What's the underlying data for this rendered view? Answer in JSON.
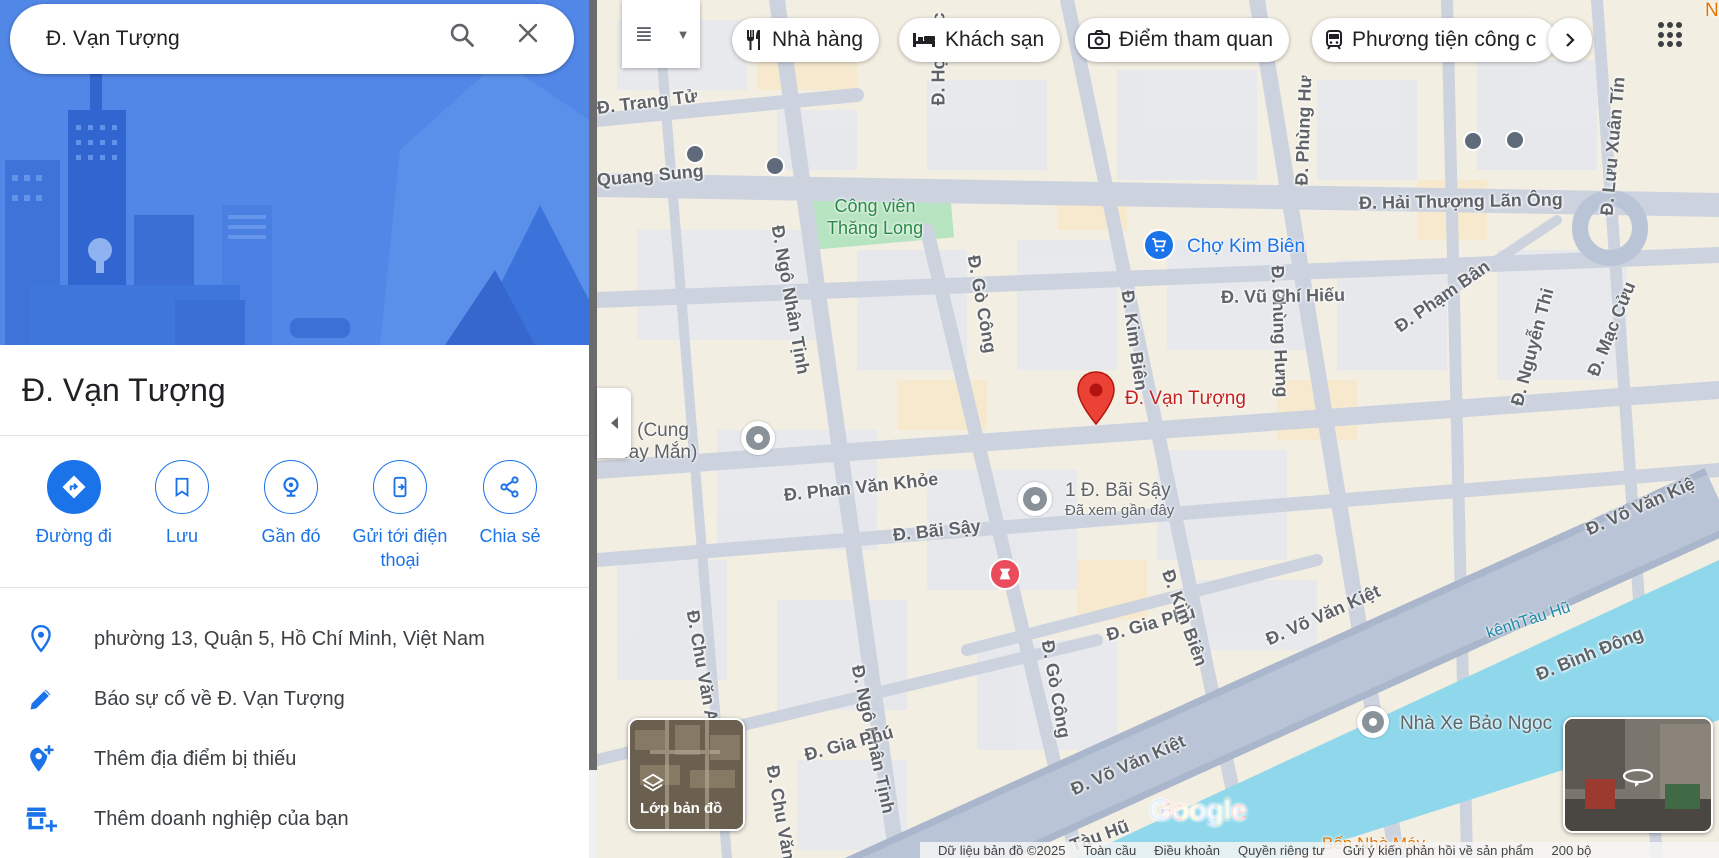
{
  "search": {
    "value": "Đ. Vạn Tượng"
  },
  "place": {
    "title": "Đ. Vạn Tượng"
  },
  "actions": [
    {
      "label": "Đường đi"
    },
    {
      "label": "Lưu"
    },
    {
      "label": "Gần đó"
    },
    {
      "label": "Gửi tới điện",
      "label2": "thoại"
    },
    {
      "label": "Chia sẻ"
    }
  ],
  "info": [
    {
      "text": "phường 13, Quận 5, Hồ Chí Minh, Việt Nam",
      "icon": "location-pin-icon"
    },
    {
      "text": "Báo sự cố về Đ. Vạn Tượng",
      "icon": "pencil-icon"
    },
    {
      "text": "Thêm địa điểm bị thiếu",
      "icon": "add-location-icon"
    },
    {
      "text": "Thêm doanh nghiệp của bạn",
      "icon": "add-business-icon"
    }
  ],
  "map": {
    "chips": [
      "Nhà hàng",
      "Khách sạn",
      "Điểm tham quan",
      "Phương tiện công c"
    ],
    "streets": [
      "Đ. Trang Tử",
      "Quang Sung",
      "Đ. Học Lạc",
      "Đ. Ngô Nhân Tịnh",
      "Đ. Gò Công",
      "Đ. Kim Biên",
      "Đ. Phùng Hưng",
      "Đ. Phùng Hư",
      "Đ. Hải Thượng Lãn Ông",
      "Đ. Vũ Chí Hiếu",
      "Đ. Phạm Bân",
      "Đ. Nguyễn Thi",
      "Đ. Mạc Cửu",
      "Đ. Lưu Xuân Tín",
      "Đ. Phan Văn Khỏe",
      "Đ. Bãi Sậy",
      "Đ. Gia Phú",
      "Đ. Chu Văn An",
      "Đ. Ngô Nhân Tịnh",
      "Đ. Gò Công",
      "Đ. Kim Biên",
      "Đ. Võ Văn Kiệt",
      "Đ. Võ Văn Kiệt",
      "Đ. Bình Đông",
      "Đ. Gia Phú",
      "Đ. Chu Văn",
      "Đ. Võ Văn Kiệ",
      "Tàu Hũ"
    ],
    "river_label": "kênhTàu Hũ",
    "park_label_1": "Công viên",
    "park_label_2": "Thăng Long",
    "market": "Chợ Kim Biên",
    "pin_label": "Đ. Vạn Tượng",
    "palace_1": "lace (Cung",
    "palace_2": "n May Mắn)",
    "recent_name": "1 Đ. Bãi Sậy",
    "recent_sub": "Đã xem gần đây",
    "bus_station": "Nhà Xe Bảo Ngọc",
    "bottom_poi": "Bến Nhà Máy...",
    "corner_letter": "N",
    "layers_label": "Lớp bản đồ",
    "google": "Google",
    "footer": [
      "Dữ liệu bản đồ ©2025",
      "Toàn cầu",
      "Điều khoản",
      "Quyền riêng tư",
      "Gửi ý kiến phản hồi về sản phẩm",
      "200 bộ"
    ]
  },
  "colors": {
    "accent": "#1a73e8",
    "pin": "#ea4335",
    "river": "#8fd8ec",
    "road": "#c9cfdb",
    "park": "#b6e3c0"
  }
}
